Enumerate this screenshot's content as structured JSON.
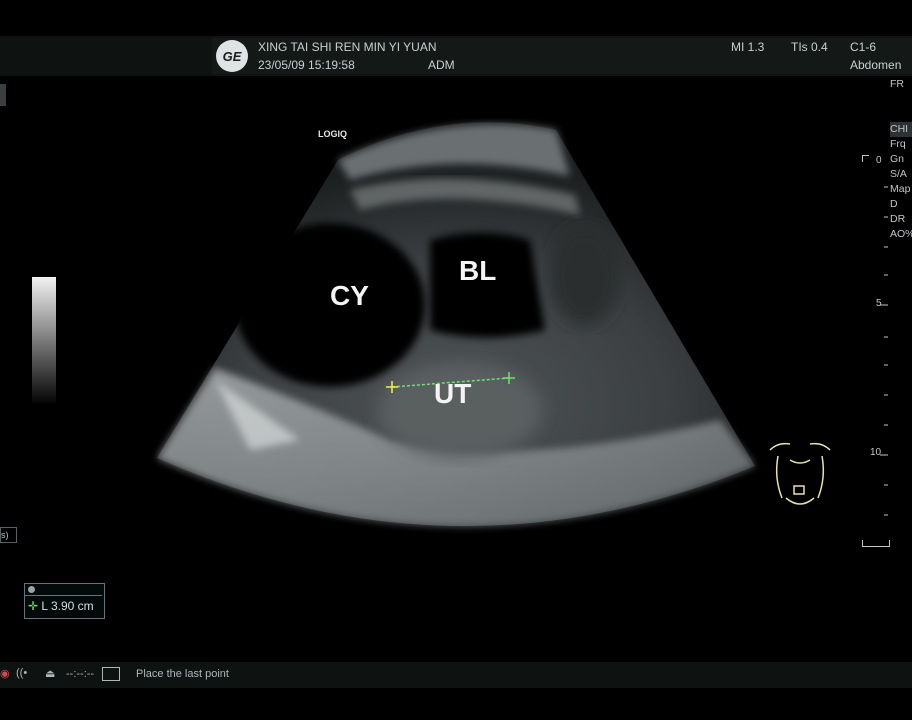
{
  "header": {
    "hospital": "XING TAI SHI REN MIN YI YUAN",
    "datetime": "23/05/09 15:19:58",
    "operator": "ADM",
    "mi": "MI 1.3",
    "tis": "TIs 0.4",
    "probe": "C1-6",
    "preset": "Abdomen",
    "fr": "FR",
    "logo": "GE"
  },
  "image": {
    "brand": "LOGIQ",
    "annotations": {
      "cyst": "CY",
      "bladder": "BL",
      "uterus": "UT"
    }
  },
  "side_params": [
    "CHI",
    "Frq",
    "Gn",
    "S/A",
    "Map",
    "D",
    "DR",
    "AO%"
  ],
  "depth_scale": {
    "top": "0",
    "mid": "5",
    "bottom": "10"
  },
  "left_edge_label": "s)",
  "measurement": {
    "value": "L 3.90 cm"
  },
  "statusbar": {
    "time": "--:--:--",
    "prompt": "Place the last point"
  },
  "colors": {
    "caliper": "#6ee06e",
    "caliper_start": "#f2f24a",
    "bodymark": "#e8e0b0"
  }
}
